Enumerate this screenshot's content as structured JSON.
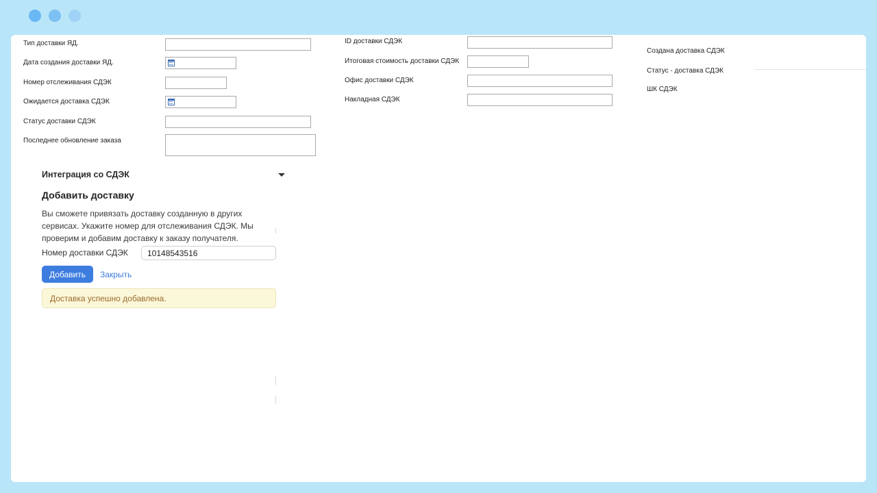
{
  "left_column": {
    "fields": [
      {
        "label": "Тип доставки ЯД.",
        "value": ""
      },
      {
        "label": "Дата создания доставки ЯД.",
        "value": ""
      },
      {
        "label": "Номер отслеживания СДЭК",
        "value": ""
      },
      {
        "label": "Ожидается доставка СДЭК",
        "value": ""
      },
      {
        "label": "Статус доставки СДЭК",
        "value": ""
      },
      {
        "label": "Последнее обновление заказа",
        "value": ""
      }
    ]
  },
  "middle_column": {
    "fields": [
      {
        "label": "ID доставки СДЭК",
        "value": ""
      },
      {
        "label": "Итоговая стоимость доставки СДЭК",
        "value": ""
      },
      {
        "label": "Офис доставки СДЭК",
        "value": ""
      },
      {
        "label": "Накладная СДЭК",
        "value": ""
      }
    ]
  },
  "right_column": {
    "labels": [
      "Создана доставка СДЭК",
      "Статус - доставка СДЭК",
      "ШК СДЭК"
    ]
  },
  "integration": {
    "section_title": "Интеграция со СДЭК",
    "heading": "Добавить доставку",
    "description": "Вы сможете привязать доставку созданную в других сервисах. Укажите номер для отслеживания СДЭК. Мы проверим и добавим доставку к заказу получателя.",
    "number_label": "Номер доставки СДЭК",
    "number_value": "10148543516",
    "add_button": "Добавить",
    "close_link": "Закрыть",
    "success_message": "Доставка успешно добавлена."
  },
  "colors": {
    "frame": "#b9e5f8",
    "accent": "#3e7de0",
    "link": "#3d7bd6",
    "success_bg": "#fbf7d9",
    "success_text": "#9a6a2a"
  }
}
